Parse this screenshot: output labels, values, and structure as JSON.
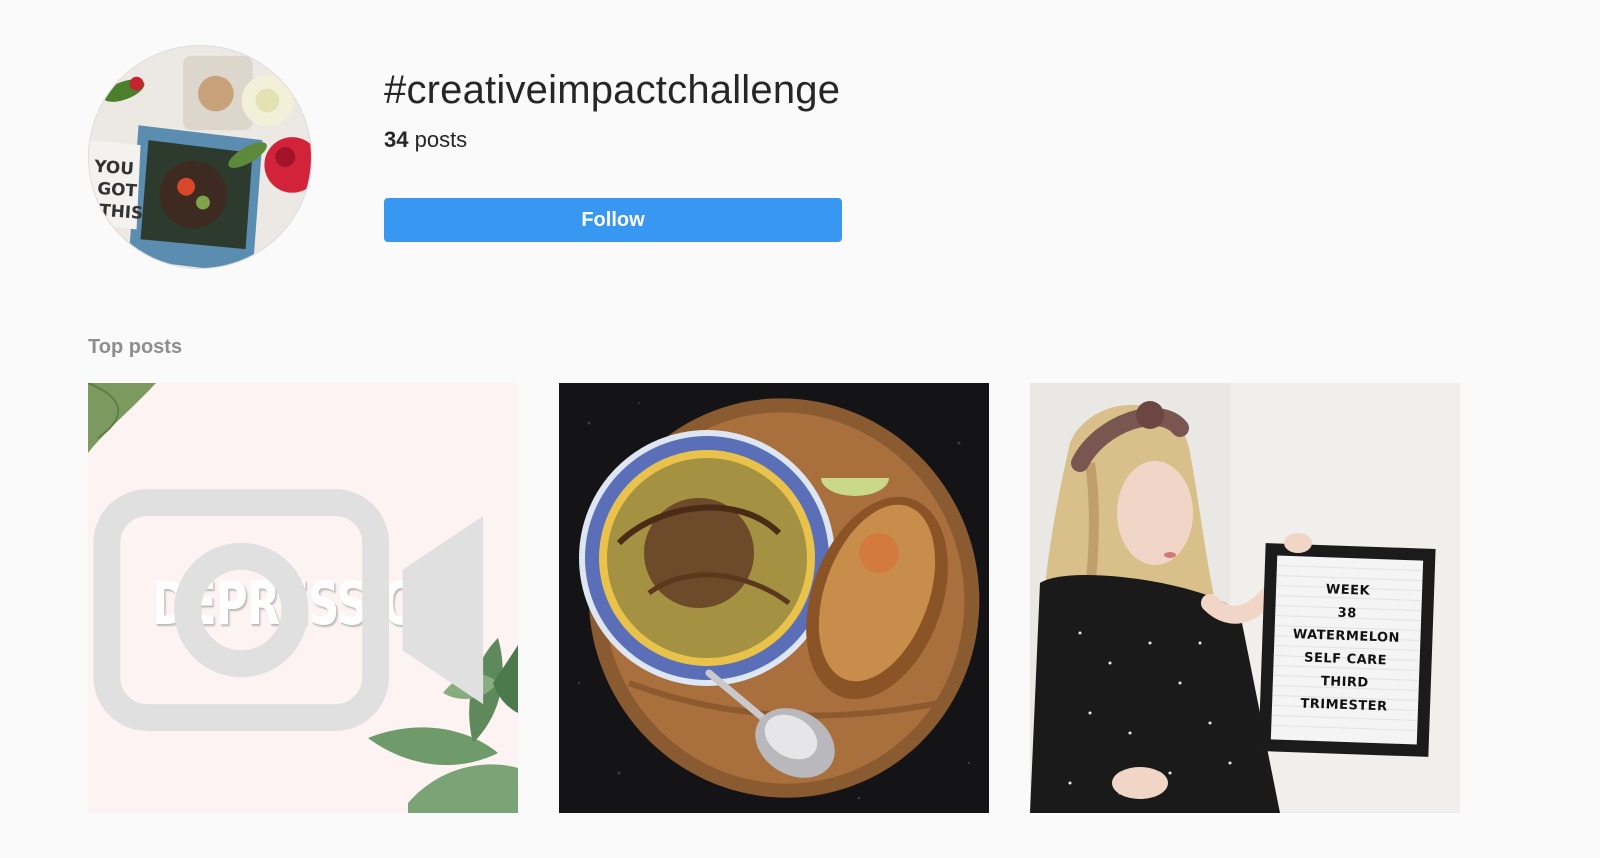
{
  "header": {
    "hashtag": "#creativeimpactchallenge",
    "post_count": "34",
    "post_count_label": " posts",
    "follow_label": "Follow",
    "avatar_text": [
      "YOU",
      "GOT",
      "THIS"
    ]
  },
  "top_posts": {
    "heading": "Top posts",
    "posts": [
      {
        "overlay_text": "DEPRESSION",
        "icon": "video-icon",
        "is_video": true
      },
      {
        "is_video": false
      },
      {
        "is_video": false,
        "letterboard": [
          "WEEK",
          "38",
          "WATERMELON",
          "SELF CARE",
          "THIRD",
          "TRIMESTER"
        ]
      }
    ]
  },
  "colors": {
    "background": "#fafafa",
    "follow_button": "#3897f0",
    "heading_gray": "#8e8e8e",
    "text": "#262626"
  }
}
